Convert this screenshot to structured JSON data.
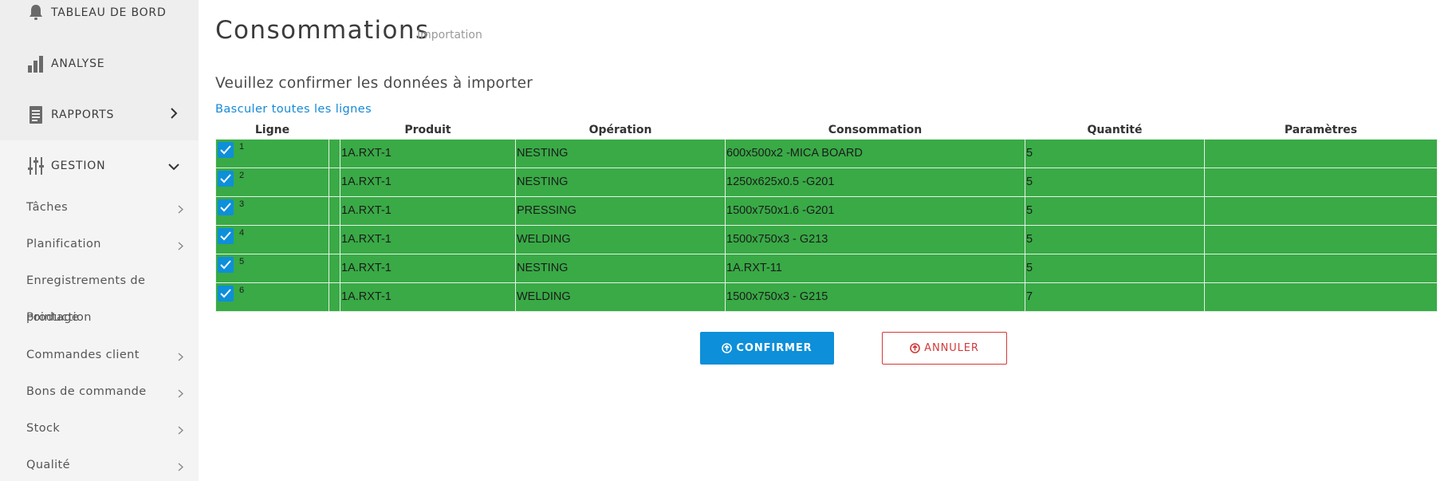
{
  "sidebar": {
    "top": [
      {
        "label": "TABLEAU DE BORD",
        "icon": "bell-icon"
      },
      {
        "label": "ANALYSE",
        "icon": "bar-chart-icon"
      },
      {
        "label": "RAPPORTS",
        "icon": "document-icon"
      },
      {
        "label": "GESTION",
        "icon": "sliders-icon"
      }
    ],
    "sub": [
      {
        "label": "Tâches"
      },
      {
        "label": "Planification"
      },
      {
        "label": "Enregistrements de"
      },
      {
        "label": "Commandes client"
      },
      {
        "label": "Bons de commande"
      },
      {
        "label": "Stock"
      },
      {
        "label": "Qualité"
      }
    ],
    "overlap_a": "production",
    "overlap_b": "Pointage"
  },
  "page": {
    "title": "Consommations",
    "subtitle": "Importation",
    "instruction": "Veuillez confirmer les données à importer",
    "toggle_all": "Basculer toutes les lignes"
  },
  "table": {
    "headers": {
      "ligne": "Ligne",
      "produit": "Produit",
      "operation": "Opération",
      "consommation": "Consommation",
      "quantite": "Quantité",
      "parametres": "Paramètres"
    },
    "rows": [
      {
        "num": "1",
        "produit": "1A.RXT-1",
        "operation": "NESTING",
        "consommation": "600x500x2 -MICA BOARD",
        "quantite": "5",
        "parametres": ""
      },
      {
        "num": "2",
        "produit": "1A.RXT-1",
        "operation": "NESTING",
        "consommation": "1250x625x0.5 -G201",
        "quantite": "5",
        "parametres": ""
      },
      {
        "num": "3",
        "produit": "1A.RXT-1",
        "operation": "PRESSING",
        "consommation": "1500x750x1.6 -G201",
        "quantite": "5",
        "parametres": ""
      },
      {
        "num": "4",
        "produit": "1A.RXT-1",
        "operation": "WELDING",
        "consommation": "1500x750x3 - G213",
        "quantite": "5",
        "parametres": ""
      },
      {
        "num": "5",
        "produit": "1A.RXT-1",
        "operation": "NESTING",
        "consommation": "1A.RXT-11",
        "quantite": "5",
        "parametres": ""
      },
      {
        "num": "6",
        "produit": "1A.RXT-1",
        "operation": "WELDING",
        "consommation": "1500x750x3 - G215",
        "quantite": "7",
        "parametres": ""
      }
    ],
    "row_color": "#39aa46"
  },
  "actions": {
    "confirm": "CONFIRMER",
    "cancel": "ANNULER"
  },
  "colors": {
    "accent": "#0d8fd9",
    "danger": "#d13a3a",
    "success": "#39aa46"
  }
}
